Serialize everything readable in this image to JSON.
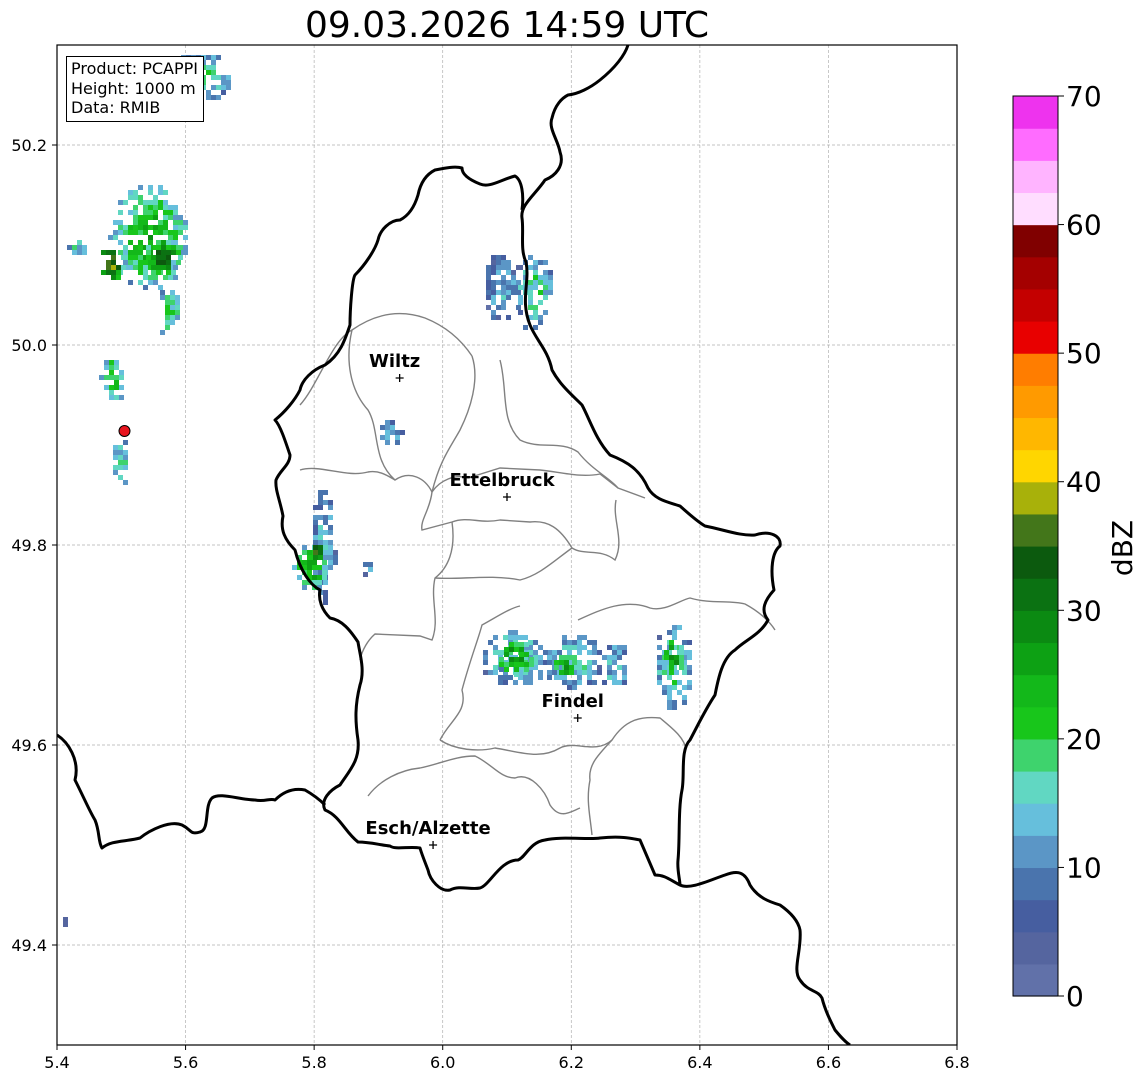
{
  "title": "09.03.2026 14:59 UTC",
  "info_box": {
    "product": "Product: PCAPPI",
    "height": "Height: 1000 m",
    "data_source": "Data: RMIB"
  },
  "map": {
    "x_axis": {
      "range": [
        5.4,
        6.8
      ],
      "ticks": [
        "5.4",
        "5.6",
        "5.8",
        "6.0",
        "6.2",
        "6.4",
        "6.6",
        "6.8"
      ]
    },
    "y_axis": {
      "range": [
        49.3,
        50.3
      ],
      "ticks": [
        "49.4",
        "49.6",
        "49.8",
        "50.0",
        "50.2"
      ]
    },
    "grid": true,
    "radar_site": {
      "lon": 5.505,
      "lat": 49.914,
      "color": "#e8141e"
    },
    "cities": [
      {
        "name": "Wiltz",
        "lon": 5.933,
        "lat": 49.967
      },
      {
        "name": "Ettelbruck",
        "lon": 6.1,
        "lat": 49.848
      },
      {
        "name": "Findel",
        "lon": 6.21,
        "lat": 49.627
      },
      {
        "name": "Esch/Alzette",
        "lon": 5.985,
        "lat": 49.5
      }
    ],
    "precip_cells": [
      {
        "lon": 5.54,
        "lat": 50.11,
        "rlon": 0.06,
        "rlat": 0.055,
        "dbz": 24
      },
      {
        "lon": 5.56,
        "lat": 50.09,
        "rlon": 0.03,
        "rlat": 0.02,
        "dbz": 32
      },
      {
        "lon": 5.48,
        "lat": 50.085,
        "rlon": 0.02,
        "rlat": 0.02,
        "dbz": 38
      },
      {
        "lon": 5.43,
        "lat": 50.1,
        "rlon": 0.015,
        "rlat": 0.01,
        "dbz": 16
      },
      {
        "lon": 5.62,
        "lat": 50.27,
        "rlon": 0.05,
        "rlat": 0.025,
        "dbz": 18
      },
      {
        "lon": 5.57,
        "lat": 50.035,
        "rlon": 0.018,
        "rlat": 0.025,
        "dbz": 20
      },
      {
        "lon": 5.485,
        "lat": 49.97,
        "rlon": 0.02,
        "rlat": 0.025,
        "dbz": 22
      },
      {
        "lon": 5.495,
        "lat": 49.885,
        "rlon": 0.015,
        "rlat": 0.025,
        "dbz": 18
      },
      {
        "lon": 5.81,
        "lat": 49.8,
        "rlon": 0.02,
        "rlat": 0.06,
        "dbz": 14
      },
      {
        "lon": 5.79,
        "lat": 49.78,
        "rlon": 0.025,
        "rlat": 0.025,
        "dbz": 26
      },
      {
        "lon": 5.8,
        "lat": 49.795,
        "rlon": 0.01,
        "rlat": 0.01,
        "dbz": 38
      },
      {
        "lon": 5.915,
        "lat": 49.915,
        "rlon": 0.02,
        "rlat": 0.015,
        "dbz": 14
      },
      {
        "lon": 5.88,
        "lat": 49.78,
        "rlon": 0.012,
        "rlat": 0.008,
        "dbz": 12
      },
      {
        "lon": 6.09,
        "lat": 50.06,
        "rlon": 0.03,
        "rlat": 0.035,
        "dbz": 12
      },
      {
        "lon": 6.14,
        "lat": 50.055,
        "rlon": 0.03,
        "rlat": 0.04,
        "dbz": 18
      },
      {
        "lon": 6.11,
        "lat": 49.69,
        "rlon": 0.055,
        "rlat": 0.03,
        "dbz": 16
      },
      {
        "lon": 6.11,
        "lat": 49.69,
        "rlon": 0.03,
        "rlat": 0.018,
        "dbz": 28
      },
      {
        "lon": 6.2,
        "lat": 49.685,
        "rlon": 0.045,
        "rlat": 0.03,
        "dbz": 16
      },
      {
        "lon": 6.185,
        "lat": 49.68,
        "rlon": 0.02,
        "rlat": 0.015,
        "dbz": 28
      },
      {
        "lon": 6.265,
        "lat": 49.68,
        "rlon": 0.025,
        "rlat": 0.025,
        "dbz": 14
      },
      {
        "lon": 6.355,
        "lat": 49.68,
        "rlon": 0.03,
        "rlat": 0.045,
        "dbz": 18
      },
      {
        "lon": 6.355,
        "lat": 49.69,
        "rlon": 0.018,
        "rlat": 0.02,
        "dbz": 28
      },
      {
        "lon": 5.41,
        "lat": 49.43,
        "rlon": 0.008,
        "rlat": 0.008,
        "dbz": 6
      }
    ]
  },
  "colorbar": {
    "label": "dBZ",
    "range": [
      0,
      70
    ],
    "ticks": [
      "0",
      "10",
      "20",
      "30",
      "40",
      "50",
      "60",
      "70"
    ],
    "colors": [
      "#6171a9",
      "#55659f",
      "#465ea0",
      "#4a74ad",
      "#5b96c6",
      "#66bfdc",
      "#61d7c2",
      "#3ed36d",
      "#18c61b",
      "#13b81a",
      "#0da114",
      "#0b8a12",
      "#0b7212",
      "#0c5a0e",
      "#43761a",
      "#a8b10a",
      "#ffd600",
      "#ffb700",
      "#ff9a00",
      "#ff7d00",
      "#e80000",
      "#c40000",
      "#a40000",
      "#800000",
      "#ffddff",
      "#ffb4ff",
      "#ff6cff",
      "#ee33ee"
    ]
  }
}
